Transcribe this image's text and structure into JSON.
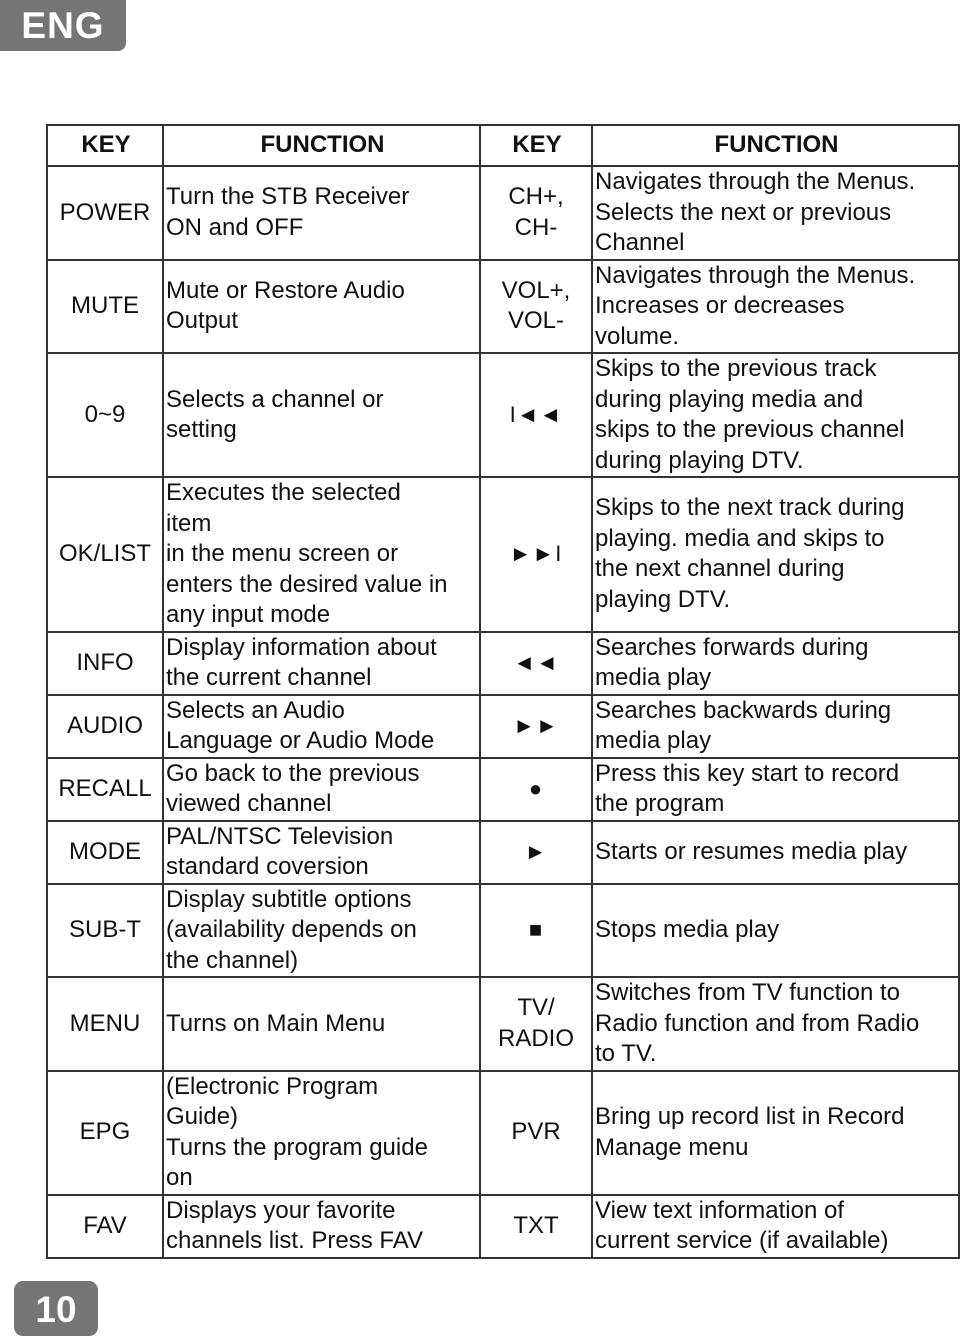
{
  "page": {
    "language_badge": "ENG",
    "page_number": "10"
  },
  "table": {
    "headers": [
      "KEY",
      "FUNCTION",
      "KEY",
      "FUNCTION"
    ],
    "rows": [
      {
        "left_key": "POWER",
        "left_function": "Turn the STB Receiver\nON and OFF",
        "right_key": "CH+,\nCH-",
        "right_function": "Navigates through the Menus.\nSelects the next or previous\nChannel"
      },
      {
        "left_key": "MUTE",
        "left_function": "Mute or Restore Audio\nOutput",
        "right_key": "VOL+,\nVOL-",
        "right_function": "Navigates through the Menus.\nIncreases or decreases\nvolume."
      },
      {
        "left_key": "0~9",
        "left_function": "Selects a channel or\nsetting",
        "right_key": "I◄◄",
        "right_key_icon": "previous-track-icon",
        "right_function": "Skips to the previous track\nduring playing media and\nskips to the previous  channel\nduring playing DTV."
      },
      {
        "left_key": "OK/LIST",
        "left_function": "Executes the selected\nitem\nin the menu screen or\nenters the desired value in\nany input mode",
        "right_key": "►►I",
        "right_key_icon": "next-track-icon",
        "right_function": "Skips to the next track during\nplaying. media and skips to\nthe next channel  during\nplaying DTV."
      },
      {
        "left_key": "INFO",
        "left_function": "Display information about\nthe current channel",
        "right_key": "◄◄",
        "right_key_icon": "rewind-icon",
        "right_function": "Searches forwards during\nmedia play"
      },
      {
        "left_key": "AUDIO",
        "left_function": "Selects an Audio\nLanguage or Audio Mode",
        "right_key": "►►",
        "right_key_icon": "fast-forward-icon",
        "right_function": "Searches backwards during\nmedia play"
      },
      {
        "left_key": "RECALL",
        "left_function": "Go back to the previous\nviewed channel",
        "right_key": "●",
        "right_key_icon": "record-icon",
        "right_function": "Press this key start to record\nthe program"
      },
      {
        "left_key": "MODE",
        "left_function": "PAL/NTSC Television\nstandard coversion",
        "right_key": "►",
        "right_key_icon": "play-icon",
        "right_function": "Starts or resumes media play"
      },
      {
        "left_key": "SUB-T",
        "left_function": "Display subtitle options\n(availability depends on\nthe channel)",
        "right_key": "■",
        "right_key_icon": "stop-icon",
        "right_function": "Stops media play"
      },
      {
        "left_key": "MENU",
        "left_function": "Turns on Main Menu",
        "right_key": "TV/\nRADIO",
        "right_function": "Switches from TV function to\nRadio function and from Radio\nto TV."
      },
      {
        "left_key": "EPG",
        "left_function": "(Electronic Program\nGuide)\nTurns the program guide\non",
        "right_key": "PVR",
        "right_function": "Bring up record list in Record\nManage menu"
      },
      {
        "left_key": "FAV",
        "left_function": "Displays your favorite\nchannels list. Press FAV",
        "right_key": "TXT",
        "right_function": "View text information of\ncurrent service (if available)"
      }
    ]
  }
}
